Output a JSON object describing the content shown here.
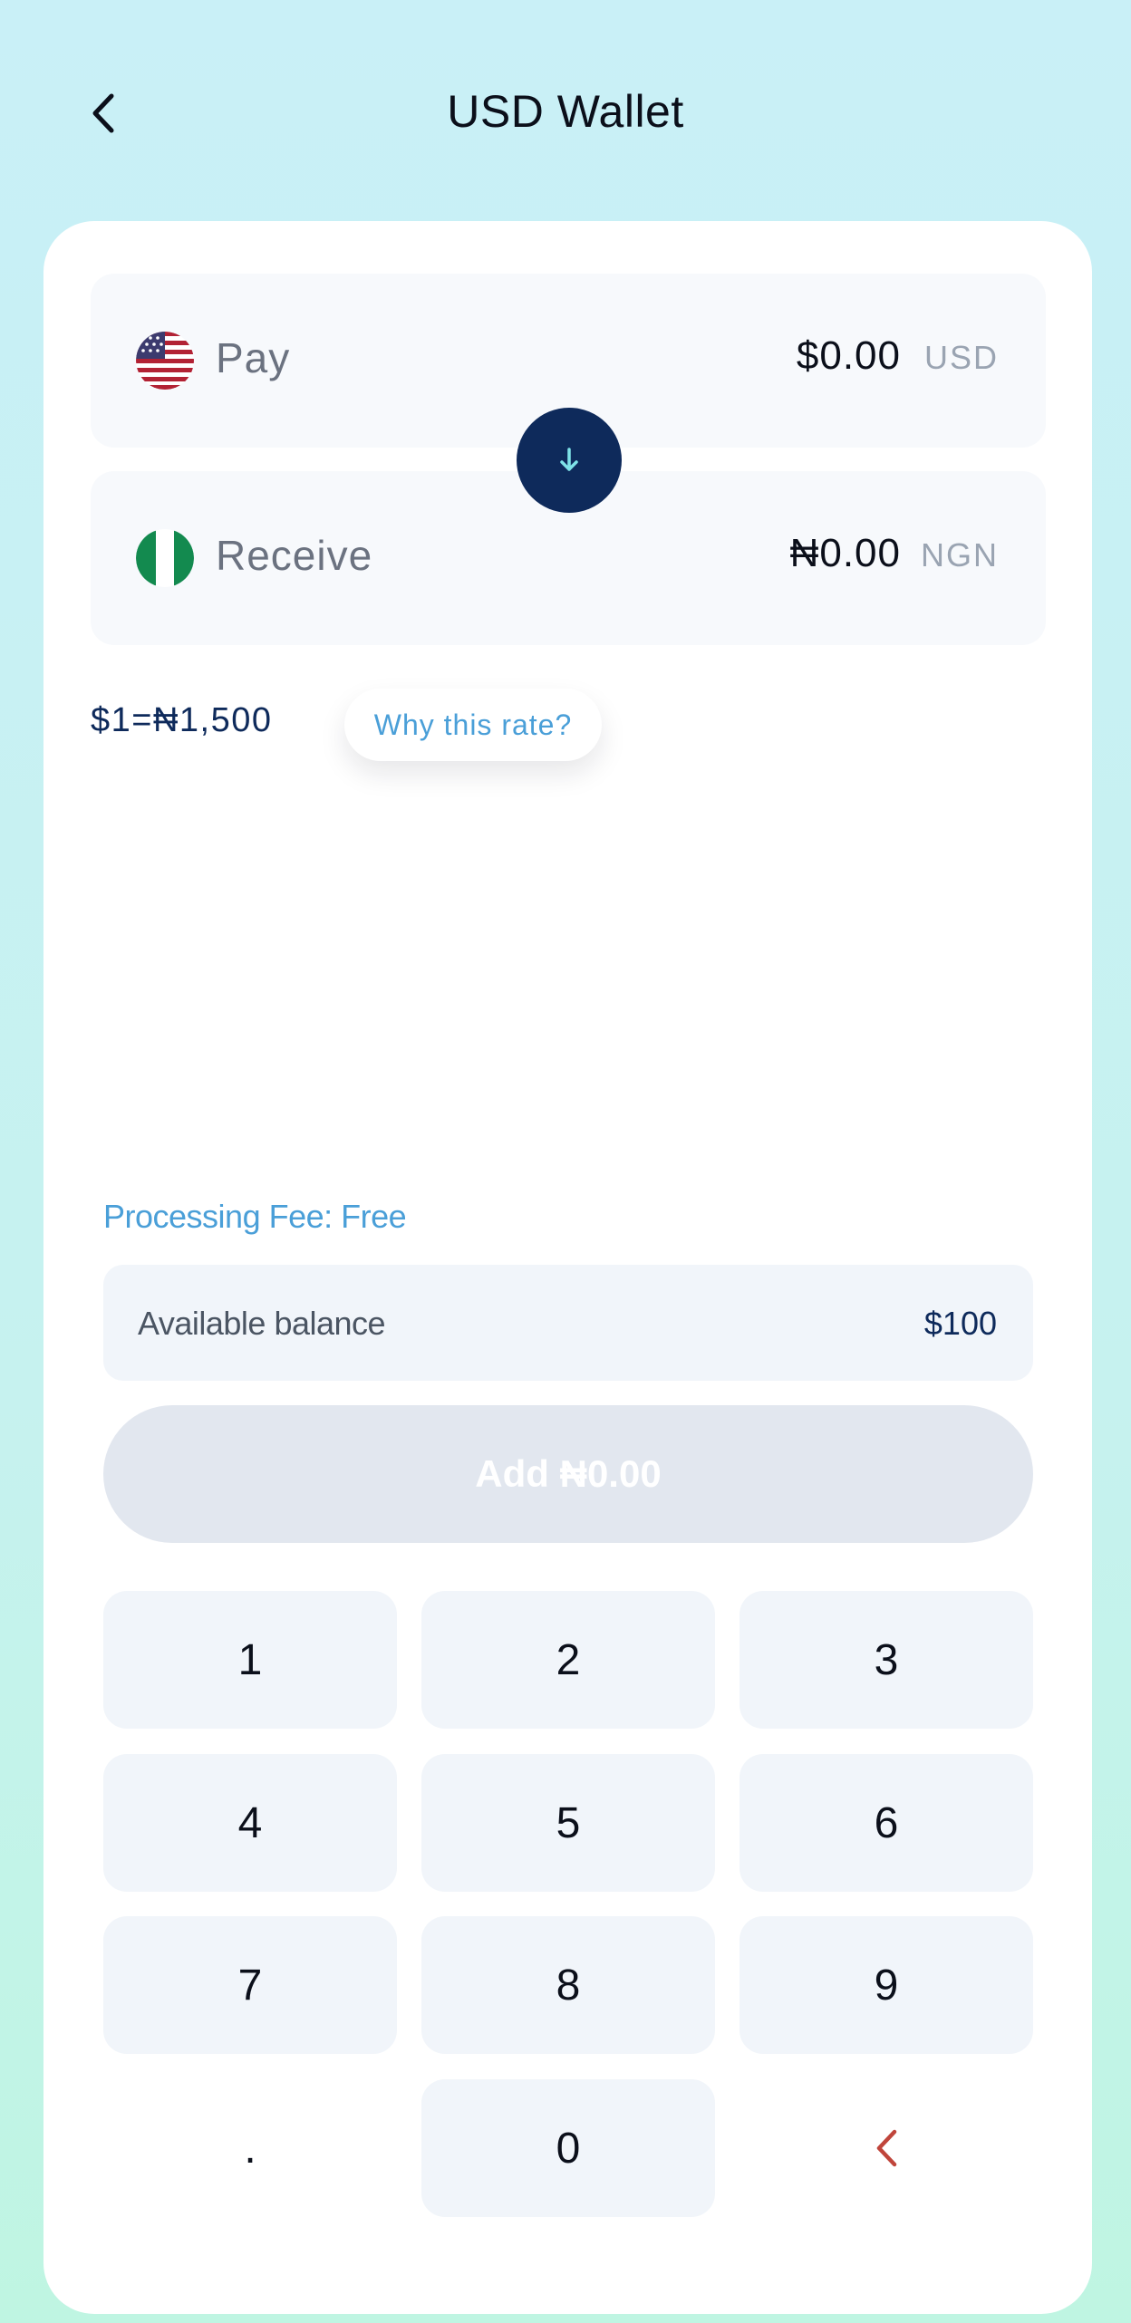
{
  "header": {
    "title": "USD Wallet"
  },
  "pay": {
    "label": "Pay",
    "amount": "$0.00",
    "currency": "USD"
  },
  "receive": {
    "label": "Receive",
    "amount": "₦0.00",
    "currency": "NGN"
  },
  "rate": {
    "text": "$1=₦1,500",
    "link_label": "Why this rate?"
  },
  "fee": {
    "text": "Processing Fee: Free"
  },
  "balance": {
    "label": "Available balance",
    "value": "$100"
  },
  "action": {
    "label": "Add ₦0.00"
  },
  "keypad": {
    "keys": [
      "1",
      "2",
      "3",
      "4",
      "5",
      "6",
      "7",
      "8",
      "9",
      ".",
      "0"
    ]
  },
  "colors": {
    "primary_dark": "#0e2a5b",
    "accent_blue": "#4a9fd8",
    "delete_red": "#c0453b",
    "disabled_button": "#e2e7ef"
  },
  "icons": {
    "back": "chevron-left-icon",
    "swap": "arrow-down-icon",
    "delete": "backspace-chevron-icon",
    "pay_flag": "us-flag-icon",
    "receive_flag": "nigeria-flag-icon"
  }
}
